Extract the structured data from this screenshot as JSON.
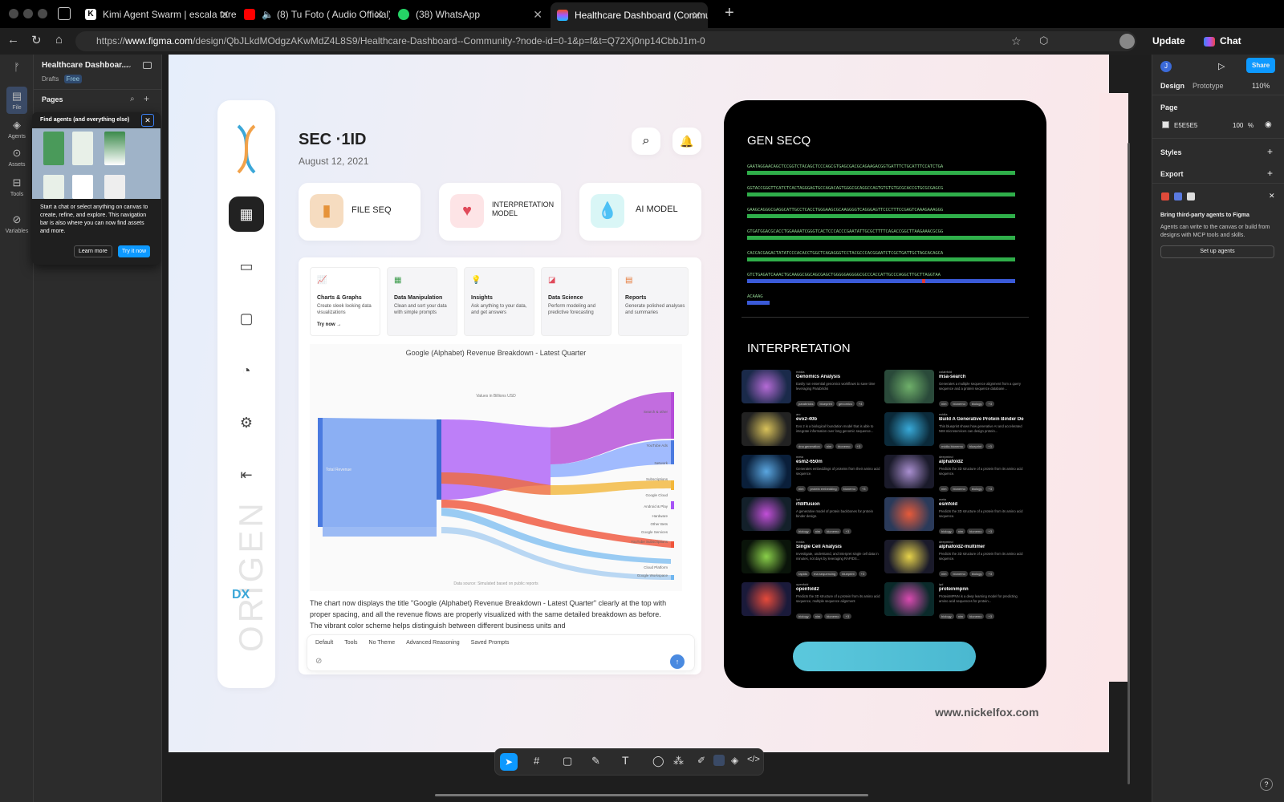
{
  "browser": {
    "tabs": [
      {
        "label": "Kimi Agent Swarm | escala tarea",
        "icon": "kimi-icon",
        "color": "#ffffff"
      },
      {
        "label": "(8) Tu Foto ( Audio Official)",
        "icon": "youtube-icon",
        "color": "#ff0000"
      },
      {
        "label": "(38) WhatsApp",
        "icon": "whatsapp-icon",
        "color": "#25d366"
      },
      {
        "label": "Healthcare Dashboard (Commu",
        "icon": "figma-icon",
        "color": "#a259ff"
      }
    ],
    "url_prefix": "https://",
    "url_host": "www.figma.com",
    "url_path": "/design/QbJLkdMOdgzAKwMdZ4L8S9/Healthcare-Dashboard--Community-?node-id=0-1&p=f&t=Q72Xj0np14CbbJ1m-0",
    "update_label": "Update",
    "chat_label": "Chat"
  },
  "figma": {
    "rail": [
      {
        "label": "File",
        "icon": "file-icon"
      },
      {
        "label": "Agents",
        "icon": "agents-icon"
      },
      {
        "label": "Assets",
        "icon": "assets-icon"
      },
      {
        "label": "Tools",
        "icon": "tools-icon"
      },
      {
        "label": "Variables",
        "icon": "variables-icon"
      }
    ],
    "file_name": "Healthcare Dashboar...",
    "drafts": "Drafts",
    "plan": "Free",
    "pages_label": "Pages",
    "popup": {
      "title": "Find agents (and everything else)",
      "body": "Start a chat or select anything on canvas to create, refine, and explore. This navigation bar is also where you can now find assets and more.",
      "learn": "Learn more",
      "try": "Try it now"
    },
    "right": {
      "design_tab": "Design",
      "prototype_tab": "Prototype",
      "zoom": "110%",
      "share": "Share",
      "page_label": "Page",
      "page_color": "E5E5E5",
      "page_opacity": "100",
      "pct": "%",
      "styles": "Styles",
      "export": "Export",
      "agents_title": "Bring third-party agents to Figma",
      "agents_body": "Agents can write to the canvas or build from designs with MCP tools and skills.",
      "setup": "Set up agents"
    }
  },
  "dashboard": {
    "title": "SEC ·1ID",
    "date": "August 12, 2021",
    "brand_vertical": "ORIGEN",
    "brand_mark": "DX",
    "website": "www.nickelfox.com",
    "cards": [
      {
        "label": "FILE SEQ",
        "color": "#f6dcc0"
      },
      {
        "label": "INTERPRETATION MODEL",
        "color": "#fde4e6"
      },
      {
        "label": "AI MODEL",
        "color": "#d9f6f6"
      }
    ],
    "tools": [
      {
        "title": "Charts & Graphs",
        "desc": "Create sleek looking data visualizations",
        "cta": "Try now →"
      },
      {
        "title": "Data Manipulation",
        "desc": "Clean and sort your data with simple prompts",
        "cta": ""
      },
      {
        "title": "Insights",
        "desc": "Ask anything to your data, and get answers",
        "cta": ""
      },
      {
        "title": "Data Science",
        "desc": "Perform modeling and predictive forecasting",
        "cta": ""
      },
      {
        "title": "Reports",
        "desc": "Generate polished analyses and summaries",
        "cta": ""
      }
    ],
    "chart_title": "Google (Alphabet) Revenue Breakdown - Latest Quarter",
    "chart_sub": "Values in Billions USD",
    "chart_source": "Data source: Simulated based on public reports",
    "sankey_left": "Total Revenue",
    "sankey_right": [
      "Search & other",
      "YouTube Ads",
      "Network",
      "Subscriptions",
      "Google Cloud",
      "Android & Play",
      "Hardware",
      "Other Bets",
      "Google Services",
      "YouTube Subscriptions",
      "Cloud Platform",
      "Google Workspace"
    ],
    "chat_text": "The chart now displays the title \"Google (Alphabet) Revenue Breakdown - Latest Quarter\" clearly at the top with proper spacing, and all the revenue flows are properly visualized with the same detailed breakdown as before. The vibrant color scheme helps distinguish between different business units and",
    "chat_chips": [
      "Default",
      "Tools",
      "No Theme",
      "Advanced Reasoning",
      "Saved Prompts"
    ],
    "gen_title": "GEN SECQ",
    "sequences": [
      "GAATAGGAACAGCTCCGGTCTACAGCTCCCAGCGTGAGCGACGCAGAAGACGGTGATTTCTGCATTTCCATCTGA",
      "GGTACCGGGTTCATCTCACTAGGGAGTGCCAGACAGTGGGCGCAGGCCAGTGTGTGTGCGCACCGTGCGCGAGCG",
      "GAAGCAGGGCGAGGCATTGCCTCACCTGGGAAGCGCAAGGGGTCAGGGAGTTCCCTTTCCGAGTCAAAGAAAGGG",
      "GTGATGGACGCACCTGGAAAATCGGGTCACTCCCACCCGAATATTGCGCTTTTCAGACCGGCTTAAGAAACGCGG",
      "CACCACGAGACTATATCCCACACCTGGCTCAGAGGGTCCTACGCCCACGGAATCTCGCTGATTGCTAGCACAGCA",
      "GTCTGAGATCAAACTGCAAGGCGGCAGCGAGCTGGGGGAGGGGCGCCCACCATTGCCCAGGCTTGCTTAGGTAA",
      "ACAAAG"
    ],
    "interp_title": "INTERPRETATION",
    "models": [
      {
        "org": "nvidia",
        "name": "Genomics Analysis",
        "desc": "Easily run essential genomics workflows to save time leveraging Parabricks",
        "tags": [
          "parabricks",
          "blueprint",
          "genomics",
          "+4"
        ],
        "c1": "#1a2a4a",
        "c2": "#b56bd6"
      },
      {
        "org": "colabfold",
        "name": "msa-search",
        "desc": "Generates a multiple sequence alignment from a query sequence and a protein sequence database...",
        "tags": [
          "nim",
          "bionemo",
          "biology",
          "+3"
        ],
        "c1": "#2a4a3a",
        "c2": "#6fb06a"
      },
      {
        "org": "arc",
        "name": "evo2-40b",
        "desc": "Evo 2 is a biological foundation model that is able to integrate information over long genomic sequence...",
        "tags": [
          "dna generation",
          "nim",
          "bionemo",
          "+3"
        ],
        "c1": "#222",
        "c2": "#d9c25a"
      },
      {
        "org": "nvidia",
        "name": "Build A Generative Protein Binder De...",
        "desc": "This blueprint shows how generative AI and accelerated NIM microservices can design protein...",
        "tags": [
          "nvidia bionemo",
          "blueprint",
          "+3"
        ],
        "c1": "#0b2a3a",
        "c2": "#38a9d8"
      },
      {
        "org": "meta",
        "name": "esm2-650m",
        "desc": "Generates embeddings of proteins from their amino acid sequence.",
        "tags": [
          "nim",
          "protein embedding",
          "bionemo",
          "+3"
        ],
        "c1": "#0a1f3a",
        "c2": "#5aa6e0"
      },
      {
        "org": "deepmind",
        "name": "alphafold2",
        "desc": "Predicts the 3D structure of a protein from its amino acid sequence.",
        "tags": [
          "nim",
          "bionemo",
          "biology",
          "+3"
        ],
        "c1": "#1a1a2a",
        "c2": "#a98fd0"
      },
      {
        "org": "ipd",
        "name": "rfdiffusion",
        "desc": "A generative model of protein backbones for protein binder design.",
        "tags": [
          "biology",
          "nim",
          "bionemo",
          "+3"
        ],
        "c1": "#13202a",
        "c2": "#c24fd8"
      },
      {
        "org": "meta",
        "name": "esmfold",
        "desc": "Predicts the 3D structure of a protein from its amino acid sequence.",
        "tags": [
          "biology",
          "nim",
          "bionemo",
          "+3"
        ],
        "c1": "#2a3a5a",
        "c2": "#e65a3a"
      },
      {
        "org": "nvidia",
        "name": "Single Cell Analysis",
        "desc": "Investigate, understand, and interpret single cell data in minutes, not days by leveraging RAPIDS...",
        "tags": [
          "rapids",
          "rna sequencing",
          "blueprint",
          "+3"
        ],
        "c1": "#0a140a",
        "c2": "#8ad04a"
      },
      {
        "org": "deepmind",
        "name": "alphafold2-multimer",
        "desc": "Predicts the 3D structure of a protein from its amino acid sequence.",
        "tags": [
          "nim",
          "bionemo",
          "biology",
          "+3"
        ],
        "c1": "#1a1a2a",
        "c2": "#e6d24a"
      },
      {
        "org": "openfold",
        "name": "openfold2",
        "desc": "Predicts the 3D structure of a protein from its amino acid sequence, multiple sequence alignment",
        "tags": [
          "biology",
          "nim",
          "bionemo",
          "+3"
        ],
        "c1": "#1a1a3a",
        "c2": "#e64a3a"
      },
      {
        "org": "ipd",
        "name": "proteinmpnn",
        "desc": "ProteinMPNN is a deep learning model for predicting amino acid sequences for protein...",
        "tags": [
          "biology",
          "nim",
          "bionemo",
          "+3"
        ],
        "c1": "#0a2a2a",
        "c2": "#d94ab0"
      }
    ],
    "accent": "#5bc8dd"
  }
}
